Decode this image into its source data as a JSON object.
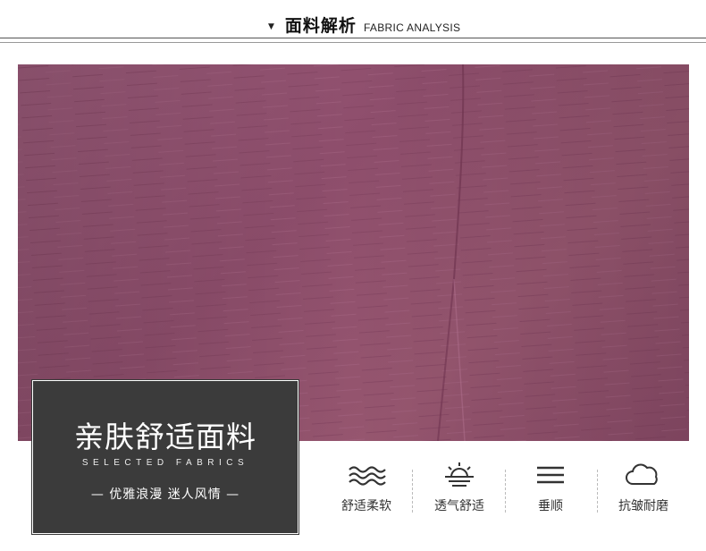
{
  "header": {
    "title_cn": "面料解析",
    "title_en": "FABRIC ANALYSIS"
  },
  "fabric_image": {
    "color": "#924f6e"
  },
  "promo_panel": {
    "title_cn": "亲肤舒适面料",
    "title_en": "SELECTED FABRICS",
    "subtitle": "— 优雅浪漫 迷人风情 —"
  },
  "features": [
    {
      "icon": "waves-icon",
      "label": "舒适柔软"
    },
    {
      "icon": "sun-horizon-icon",
      "label": "透气舒适"
    },
    {
      "icon": "lines-icon",
      "label": "垂顺"
    },
    {
      "icon": "cloud-icon",
      "label": "抗皱耐磨"
    }
  ]
}
